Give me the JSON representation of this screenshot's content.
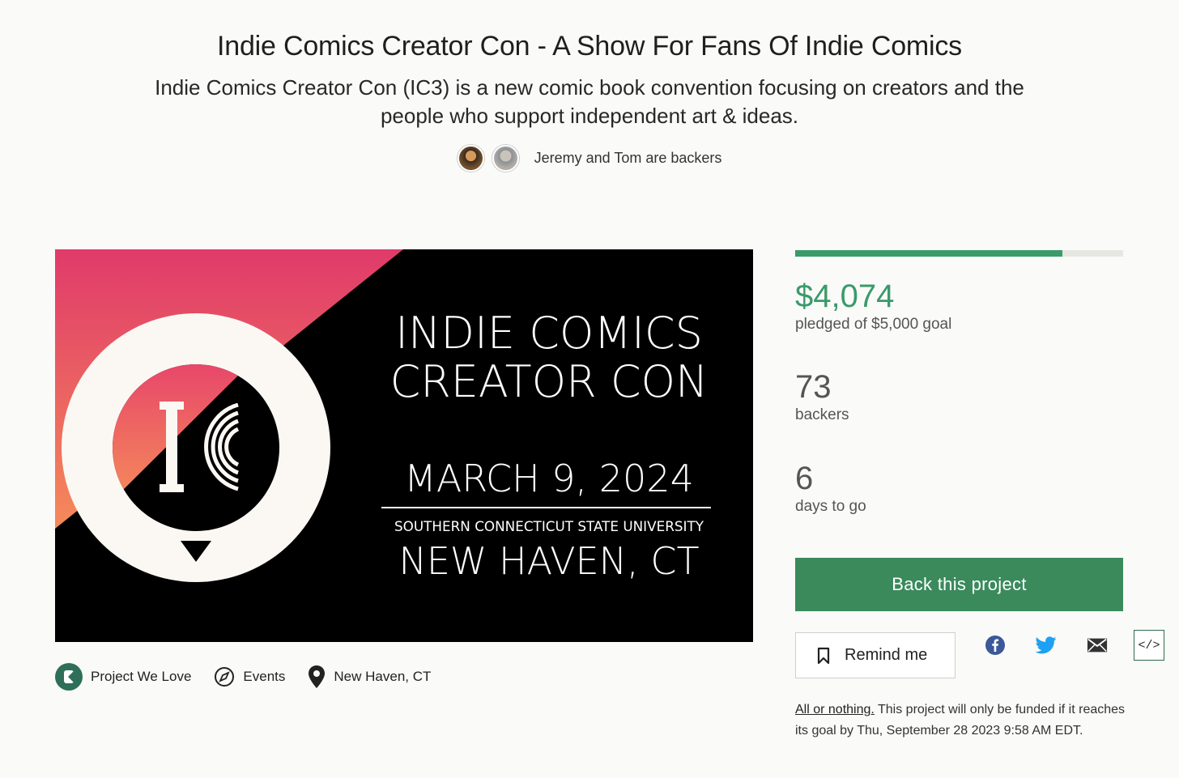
{
  "project": {
    "title": "Indie Comics Creator Con - A Show For Fans Of Indie Comics",
    "blurb": "Indie Comics Creator Con (IC3) is a new comic book convention focusing on creators and the people who support independent art & ideas.",
    "backers_note": "Jeremy and Tom are backers"
  },
  "hero": {
    "logo_letters": "IC",
    "line1": "INDIE COMICS",
    "line2": "CREATOR CON",
    "date": "MARCH 9, 2024",
    "venue": "SOUTHERN CONNECTICUT STATE UNIVERSITY",
    "city": "NEW HAVEN, CT"
  },
  "tags": {
    "badge": "Project We Love",
    "category": "Events",
    "location": "New Haven, CT"
  },
  "funding": {
    "progress_fraction": 0.8148,
    "pledged": "$4,074",
    "pledged_label": "pledged of $5,000 goal",
    "backers": "73",
    "backers_label": "backers",
    "days": "6",
    "days_label": "days to go"
  },
  "actions": {
    "back_label": "Back this project",
    "remind_label": "Remind me",
    "embed_label": "</>"
  },
  "share_icons": [
    "facebook-icon",
    "twitter-icon",
    "email-icon",
    "embed-icon"
  ],
  "all_or_nothing": {
    "link": "All or nothing.",
    "text": " This project will only be funded if it reaches its goal by Thu, September 28 2023 9:58 AM EDT."
  },
  "colors": {
    "accent_green": "#3a9a6a",
    "button_green": "#3a8a5c",
    "hero_pink": "#e03a6a",
    "hero_orange": "#f58a5a"
  }
}
